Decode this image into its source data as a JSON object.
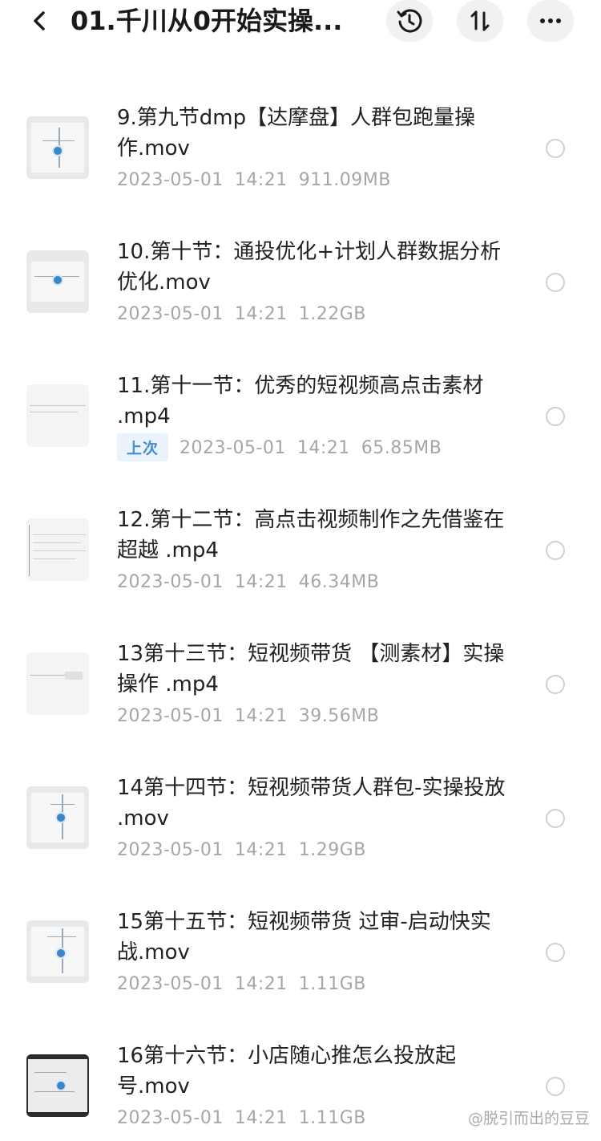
{
  "header": {
    "title": "01.千川从0开始实操...",
    "back_icon": "chevron-left-icon",
    "history_icon": "history-clock-icon",
    "sort_icon": "sort-icon",
    "more_icon": "more-dots-icon"
  },
  "files": [
    {
      "name": "9.第九节dmp【达摩盘】人群包跑量操作.mov",
      "date": "2023-05-01",
      "time": "14:21",
      "size": "911.09MB",
      "badge": ""
    },
    {
      "name": "10.第十节：通投优化+计划人群数据分析优化.mov",
      "date": "2023-05-01",
      "time": "14:21",
      "size": "1.22GB",
      "badge": ""
    },
    {
      "name": "11.第十一节：优秀的短视频高点击素材 .mp4",
      "date": "2023-05-01",
      "time": "14:21",
      "size": "65.85MB",
      "badge": "上次"
    },
    {
      "name": "12.第十二节：高点击视频制作之先借鉴在超越 .mp4",
      "date": "2023-05-01",
      "time": "14:21",
      "size": "46.34MB",
      "badge": ""
    },
    {
      "name": "13第十三节：短视频带货 【测素材】实操操作 .mp4",
      "date": "2023-05-01",
      "time": "14:21",
      "size": "39.56MB",
      "badge": ""
    },
    {
      "name": "14第十四节：短视频带货人群包-实操投放 .mov",
      "date": "2023-05-01",
      "time": "14:21",
      "size": "1.29GB",
      "badge": ""
    },
    {
      "name": "15第十五节：短视频带货 过审-启动快实战.mov",
      "date": "2023-05-01",
      "time": "14:21",
      "size": "1.11GB",
      "badge": ""
    },
    {
      "name": "16第十六节：小店随心推怎么投放起号.mov",
      "date": "2023-05-01",
      "time": "14:21",
      "size": "1.11GB",
      "badge": ""
    }
  ],
  "watermark": "@脱引而出的豆豆",
  "colors": {
    "accent": "#4a8ad0",
    "badge_bg": "#eaf3fb",
    "meta_text": "#a6a6a6"
  }
}
